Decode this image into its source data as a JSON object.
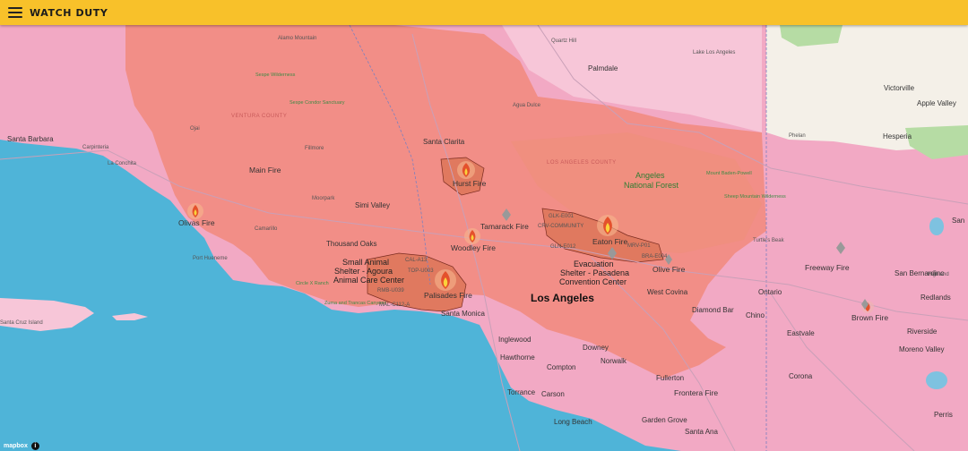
{
  "app": {
    "title": "WATCH DUTY",
    "menu_icon": "hamburger-menu-icon",
    "accent_color": "#f8c12a"
  },
  "map": {
    "colors": {
      "ocean": "#4fb4d8",
      "land": "#f2a9c4",
      "land_light": "#f7c6d8",
      "evacuation_zone": "#f2897c",
      "fire_perimeter": "#f08a74",
      "desert": "#f3efe7",
      "park": "#a7d59b"
    },
    "fire_labels": [
      {
        "id": "hurst",
        "name": "Hurst Fire"
      },
      {
        "id": "olivas",
        "name": "Olivas Fire"
      },
      {
        "id": "woodley",
        "name": "Woodley Fire"
      },
      {
        "id": "tamarack",
        "name": "Tamarack Fire"
      },
      {
        "id": "eaton",
        "name": "Eaton Fire"
      },
      {
        "id": "palisades",
        "name": "Palisades Fire"
      },
      {
        "id": "olive",
        "name": "Olive Fire"
      },
      {
        "id": "freeway",
        "name": "Freeway Fire"
      },
      {
        "id": "brown",
        "name": "Brown Fire"
      },
      {
        "id": "frontera",
        "name": "Frontera Fire"
      },
      {
        "id": "main",
        "name": "Main Fire"
      }
    ],
    "shelters": [
      {
        "id": "small-animal",
        "lines": [
          "Small Animal",
          "Shelter - Agoura",
          "Animal Care Center"
        ]
      },
      {
        "id": "evacuation-pasadena",
        "lines": [
          "Evacuation",
          "Shelter - Pasadena",
          "Convention Center"
        ]
      }
    ],
    "forest": {
      "lines": [
        "Angeles",
        "National Forest"
      ]
    },
    "major_city": "Los Angeles",
    "cities": [
      {
        "id": "santa-barbara",
        "name": "Santa Barbara"
      },
      {
        "id": "carpinteria",
        "name": "Carpinteria"
      },
      {
        "id": "la-conchita",
        "name": "La Conchita"
      },
      {
        "id": "ojai",
        "name": "Ojai"
      },
      {
        "id": "fillmore",
        "name": "Fillmore"
      },
      {
        "id": "santa-clarita",
        "name": "Santa Clarita"
      },
      {
        "id": "palmdale",
        "name": "Palmdale"
      },
      {
        "id": "quartz-hill",
        "name": "Quartz Hill"
      },
      {
        "id": "lake-los-angeles",
        "name": "Lake Los Angeles"
      },
      {
        "id": "victorville",
        "name": "Victorville"
      },
      {
        "id": "apple-valley",
        "name": "Apple Valley"
      },
      {
        "id": "hesperia",
        "name": "Hesperia"
      },
      {
        "id": "phelan",
        "name": "Phelan"
      },
      {
        "id": "moorpark",
        "name": "Moorpark"
      },
      {
        "id": "simi-valley",
        "name": "Simi Valley"
      },
      {
        "id": "camarillo",
        "name": "Camarillo"
      },
      {
        "id": "thousand-oaks",
        "name": "Thousand Oaks"
      },
      {
        "id": "port-hueneme",
        "name": "Port Hueneme"
      },
      {
        "id": "santa-monica",
        "name": "Santa Monica"
      },
      {
        "id": "inglewood",
        "name": "Inglewood"
      },
      {
        "id": "hawthorne",
        "name": "Hawthorne"
      },
      {
        "id": "torrance",
        "name": "Torrance"
      },
      {
        "id": "carson",
        "name": "Carson"
      },
      {
        "id": "compton",
        "name": "Compton"
      },
      {
        "id": "downey",
        "name": "Downey"
      },
      {
        "id": "norwalk",
        "name": "Norwalk"
      },
      {
        "id": "long-beach",
        "name": "Long Beach"
      },
      {
        "id": "west-covina",
        "name": "West Covina"
      },
      {
        "id": "diamond-bar",
        "name": "Diamond Bar"
      },
      {
        "id": "ontario",
        "name": "Ontario"
      },
      {
        "id": "chino",
        "name": "Chino"
      },
      {
        "id": "eastvale",
        "name": "Eastvale"
      },
      {
        "id": "corona",
        "name": "Corona"
      },
      {
        "id": "fullerton",
        "name": "Fullerton"
      },
      {
        "id": "garden-grove",
        "name": "Garden Grove"
      },
      {
        "id": "santa-ana",
        "name": "Santa Ana"
      },
      {
        "id": "san-bernardino",
        "name": "San Bernardino"
      },
      {
        "id": "highland",
        "name": "Highland"
      },
      {
        "id": "redlands",
        "name": "Redlands"
      },
      {
        "id": "moreno-valley",
        "name": "Moreno Valley"
      },
      {
        "id": "riverside",
        "name": "Riverside"
      },
      {
        "id": "perris",
        "name": "Perris"
      },
      {
        "id": "san-edge",
        "name": "San"
      }
    ],
    "small_labels": [
      {
        "id": "alamo-mountain",
        "name": "Alamo Mountain"
      },
      {
        "id": "sespe-wilderness",
        "name": "Sespe Wilderness"
      },
      {
        "id": "sespe-condor",
        "name": "Sespe Condor Sanctuary"
      },
      {
        "id": "ventura-county",
        "name": "VENTURA COUNTY"
      },
      {
        "id": "los-angeles-county",
        "name": "LOS ANGELES COUNTY"
      },
      {
        "id": "agua-dulce",
        "name": "Agua Dulce"
      },
      {
        "id": "mount-baden-powell",
        "name": "Mount Baden-Powell"
      },
      {
        "id": "sheep-mountain",
        "name": "Sheep Mountain Wilderness"
      },
      {
        "id": "circle-x-ranch",
        "name": "Circle X Ranch"
      },
      {
        "id": "zuma-trancas",
        "name": "Zuma and Trancas Canyons"
      },
      {
        "id": "santa-cruz-island",
        "name": "Santa Cruz Island"
      },
      {
        "id": "turtles-beak",
        "name": "Turtle's Beak"
      }
    ],
    "zone_codes": [
      {
        "id": "glk",
        "name": "GLK-E001"
      },
      {
        "id": "crv",
        "name": "CRV-COMMUNITY"
      },
      {
        "id": "gln",
        "name": "GLN-E012"
      },
      {
        "id": "bra",
        "name": "BRA-E004"
      },
      {
        "id": "mrv",
        "name": "MRV-P01"
      },
      {
        "id": "cal",
        "name": "CAL-A13"
      },
      {
        "id": "top",
        "name": "TOP-U003"
      },
      {
        "id": "rmb",
        "name": "RMB-U039"
      },
      {
        "id": "mal",
        "name": "MAL-C112-A"
      }
    ],
    "attribution": "mapbox",
    "info_icon": "info-icon"
  }
}
